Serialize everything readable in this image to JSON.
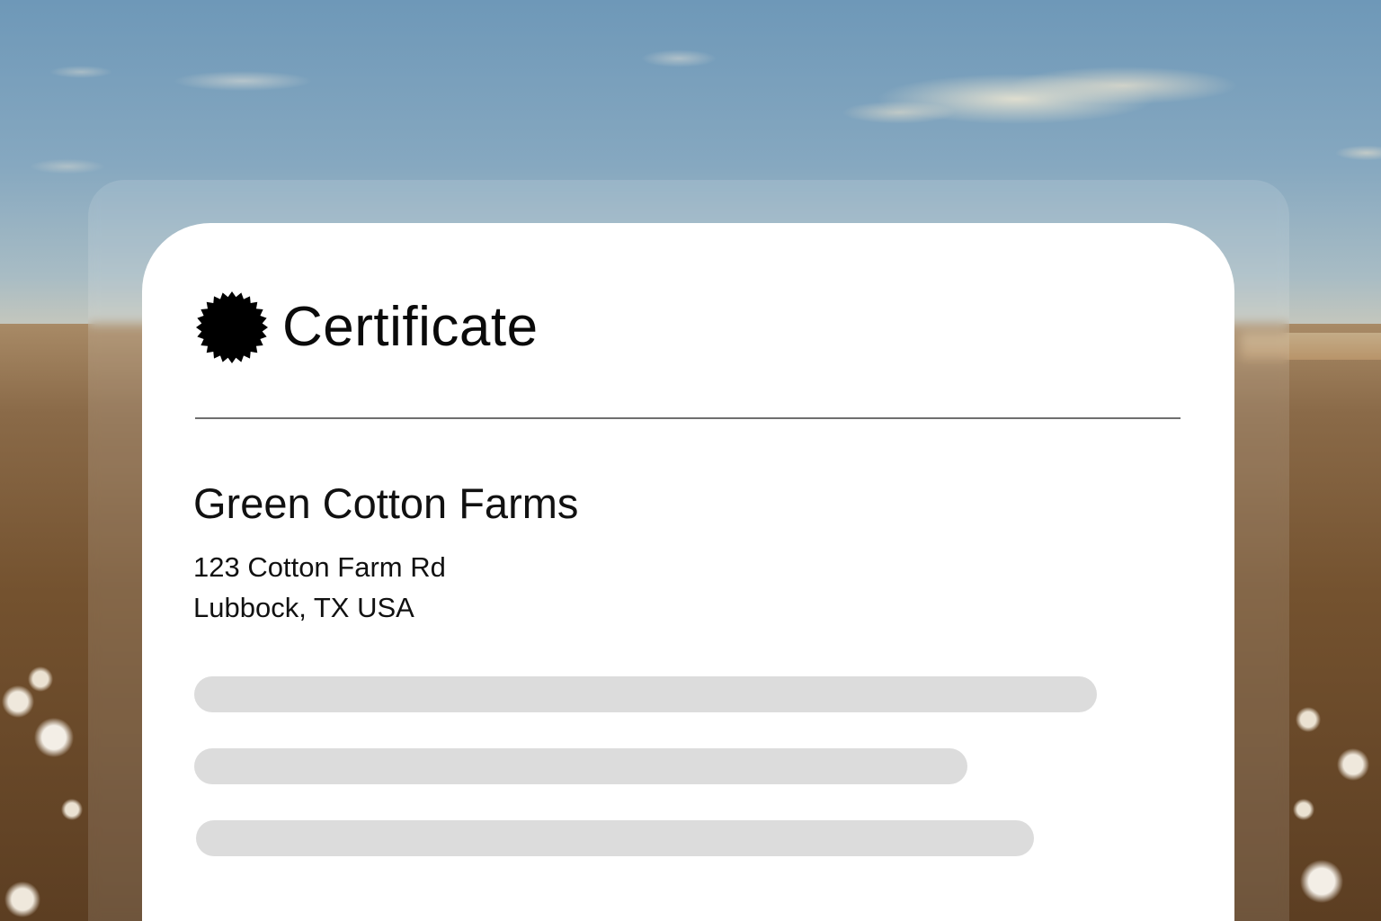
{
  "certificate": {
    "title": "Certificate",
    "badge_icon": "seal-badge-icon"
  },
  "organization": {
    "name": "Green Cotton Farms",
    "address_line1": "123 Cotton Farm Rd",
    "address_line2": "Lubbock, TX USA"
  },
  "colors": {
    "card_background": "#ffffff",
    "text": "#0a0a0a",
    "placeholder_line": "#dcdcdc",
    "divider": "#6f6f6f"
  }
}
